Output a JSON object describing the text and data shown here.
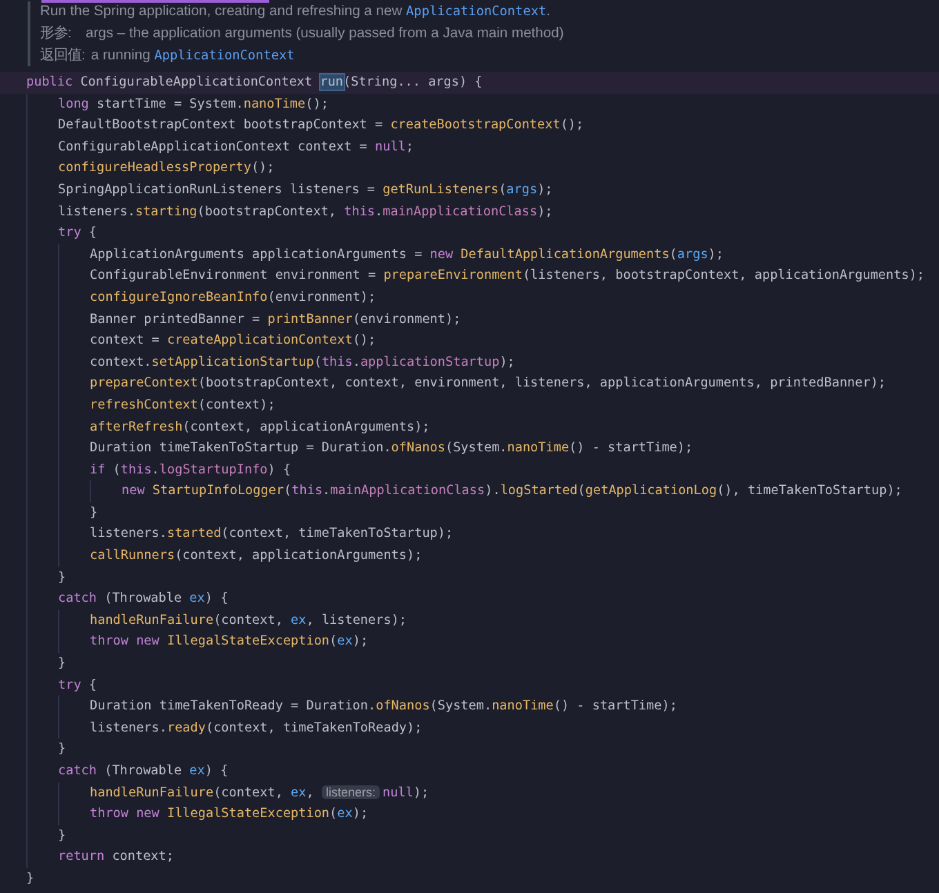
{
  "doc": [
    {
      "tokens": [
        {
          "kind": "text",
          "text": "Run the Spring application, creating and refreshing a new "
        },
        {
          "kind": "link",
          "text": "ApplicationContext"
        },
        {
          "kind": "text",
          "text": "."
        }
      ]
    },
    {
      "tokens": [
        {
          "kind": "label",
          "text": "形参:"
        },
        {
          "kind": "text",
          "text": "args – the application arguments (usually passed from a Java main method)"
        }
      ]
    },
    {
      "tokens": [
        {
          "kind": "label",
          "text": "返回值:"
        },
        {
          "kind": "text",
          "text": "a running "
        },
        {
          "kind": "link",
          "text": "ApplicationContext"
        }
      ]
    }
  ],
  "code": [
    {
      "tokens": [
        {
          "kind": "keyword",
          "text": "public"
        },
        {
          "kind": "plain",
          "text": " ConfigurableApplicationContext "
        },
        {
          "kind": "match",
          "text": "run"
        },
        {
          "kind": "plain",
          "text": "(String... args) {"
        }
      ],
      "children": [
        {
          "tokens": [
            {
              "kind": "keyword",
              "text": "long"
            },
            {
              "kind": "plain",
              "text": " startTime = System."
            },
            {
              "kind": "method",
              "text": "nanoTime"
            },
            {
              "kind": "plain",
              "text": "();"
            }
          ]
        },
        {
          "tokens": [
            {
              "kind": "plain",
              "text": "DefaultBootstrapContext bootstrapContext = "
            },
            {
              "kind": "method",
              "text": "createBootstrapContext"
            },
            {
              "kind": "plain",
              "text": "();"
            }
          ]
        },
        {
          "tokens": [
            {
              "kind": "plain",
              "text": "ConfigurableApplicationContext context = "
            },
            {
              "kind": "keyword",
              "text": "null"
            },
            {
              "kind": "plain",
              "text": ";"
            }
          ]
        },
        {
          "tokens": [
            {
              "kind": "method",
              "text": "configureHeadlessProperty"
            },
            {
              "kind": "plain",
              "text": "();"
            }
          ]
        },
        {
          "tokens": [
            {
              "kind": "plain",
              "text": "SpringApplicationRunListeners listeners = "
            },
            {
              "kind": "method",
              "text": "getRunListeners"
            },
            {
              "kind": "plain",
              "text": "("
            },
            {
              "kind": "param",
              "text": "args"
            },
            {
              "kind": "plain",
              "text": ");"
            }
          ]
        },
        {
          "tokens": [
            {
              "kind": "plain",
              "text": "listeners."
            },
            {
              "kind": "method",
              "text": "starting"
            },
            {
              "kind": "plain",
              "text": "(bootstrapContext, "
            },
            {
              "kind": "keyword",
              "text": "this"
            },
            {
              "kind": "plain",
              "text": "."
            },
            {
              "kind": "field",
              "text": "mainApplicationClass"
            },
            {
              "kind": "plain",
              "text": ");"
            }
          ]
        },
        {
          "tokens": [
            {
              "kind": "keyword",
              "text": "try"
            },
            {
              "kind": "plain",
              "text": " {"
            }
          ],
          "children": [
            {
              "tokens": [
                {
                  "kind": "plain",
                  "text": "ApplicationArguments applicationArguments = "
                },
                {
                  "kind": "keyword",
                  "text": "new "
                },
                {
                  "kind": "method",
                  "text": "DefaultApplicationArguments"
                },
                {
                  "kind": "plain",
                  "text": "("
                },
                {
                  "kind": "param",
                  "text": "args"
                },
                {
                  "kind": "plain",
                  "text": ");"
                }
              ]
            },
            {
              "tokens": [
                {
                  "kind": "plain",
                  "text": "ConfigurableEnvironment environment = "
                },
                {
                  "kind": "method",
                  "text": "prepareEnvironment"
                },
                {
                  "kind": "plain",
                  "text": "(listeners, bootstrapContext, applicationArguments);"
                }
              ]
            },
            {
              "tokens": [
                {
                  "kind": "method",
                  "text": "configureIgnoreBeanInfo"
                },
                {
                  "kind": "plain",
                  "text": "(environment);"
                }
              ]
            },
            {
              "tokens": [
                {
                  "kind": "plain",
                  "text": "Banner printedBanner = "
                },
                {
                  "kind": "method",
                  "text": "printBanner"
                },
                {
                  "kind": "plain",
                  "text": "(environment);"
                }
              ]
            },
            {
              "tokens": [
                {
                  "kind": "plain",
                  "text": "context = "
                },
                {
                  "kind": "method",
                  "text": "createApplicationContext"
                },
                {
                  "kind": "plain",
                  "text": "();"
                }
              ]
            },
            {
              "tokens": [
                {
                  "kind": "plain",
                  "text": "context."
                },
                {
                  "kind": "method",
                  "text": "setApplicationStartup"
                },
                {
                  "kind": "plain",
                  "text": "("
                },
                {
                  "kind": "keyword",
                  "text": "this"
                },
                {
                  "kind": "plain",
                  "text": "."
                },
                {
                  "kind": "field",
                  "text": "applicationStartup"
                },
                {
                  "kind": "plain",
                  "text": ");"
                }
              ]
            },
            {
              "tokens": [
                {
                  "kind": "method",
                  "text": "prepareContext"
                },
                {
                  "kind": "plain",
                  "text": "(bootstrapContext, context, environment, listeners, applicationArguments, printedBanner);"
                }
              ]
            },
            {
              "tokens": [
                {
                  "kind": "method",
                  "text": "refreshContext"
                },
                {
                  "kind": "plain",
                  "text": "(context);"
                }
              ]
            },
            {
              "tokens": [
                {
                  "kind": "method",
                  "text": "afterRefresh"
                },
                {
                  "kind": "plain",
                  "text": "(context, applicationArguments);"
                }
              ]
            },
            {
              "tokens": [
                {
                  "kind": "plain",
                  "text": "Duration timeTakenToStartup = Duration."
                },
                {
                  "kind": "method",
                  "text": "ofNanos"
                },
                {
                  "kind": "plain",
                  "text": "(System."
                },
                {
                  "kind": "method",
                  "text": "nanoTime"
                },
                {
                  "kind": "plain",
                  "text": "() - startTime);"
                }
              ]
            },
            {
              "tokens": [
                {
                  "kind": "keyword",
                  "text": "if"
                },
                {
                  "kind": "plain",
                  "text": " ("
                },
                {
                  "kind": "keyword",
                  "text": "this"
                },
                {
                  "kind": "plain",
                  "text": "."
                },
                {
                  "kind": "field",
                  "text": "logStartupInfo"
                },
                {
                  "kind": "plain",
                  "text": ") {"
                }
              ],
              "children": [
                {
                  "tokens": [
                    {
                      "kind": "keyword",
                      "text": "new "
                    },
                    {
                      "kind": "method",
                      "text": "StartupInfoLogger"
                    },
                    {
                      "kind": "plain",
                      "text": "("
                    },
                    {
                      "kind": "keyword",
                      "text": "this"
                    },
                    {
                      "kind": "plain",
                      "text": "."
                    },
                    {
                      "kind": "field",
                      "text": "mainApplicationClass"
                    },
                    {
                      "kind": "plain",
                      "text": ")."
                    },
                    {
                      "kind": "method",
                      "text": "logStarted"
                    },
                    {
                      "kind": "plain",
                      "text": "("
                    },
                    {
                      "kind": "method",
                      "text": "getApplicationLog"
                    },
                    {
                      "kind": "plain",
                      "text": "(), timeTakenToStartup);"
                    }
                  ]
                }
              ]
            },
            {
              "tokens": [
                {
                  "kind": "plain",
                  "text": "}"
                }
              ]
            },
            {
              "tokens": [
                {
                  "kind": "plain",
                  "text": "listeners."
                },
                {
                  "kind": "method",
                  "text": "started"
                },
                {
                  "kind": "plain",
                  "text": "(context, timeTakenToStartup);"
                }
              ]
            },
            {
              "tokens": [
                {
                  "kind": "method",
                  "text": "callRunners"
                },
                {
                  "kind": "plain",
                  "text": "(context, applicationArguments);"
                }
              ]
            }
          ]
        },
        {
          "tokens": [
            {
              "kind": "plain",
              "text": "}"
            }
          ]
        },
        {
          "tokens": [
            {
              "kind": "keyword",
              "text": "catch"
            },
            {
              "kind": "plain",
              "text": " (Throwable "
            },
            {
              "kind": "param",
              "text": "ex"
            },
            {
              "kind": "plain",
              "text": ") {"
            }
          ],
          "children": [
            {
              "tokens": [
                {
                  "kind": "method",
                  "text": "handleRunFailure"
                },
                {
                  "kind": "plain",
                  "text": "(context, "
                },
                {
                  "kind": "param",
                  "text": "ex"
                },
                {
                  "kind": "plain",
                  "text": ", listeners);"
                }
              ]
            },
            {
              "tokens": [
                {
                  "kind": "keyword",
                  "text": "throw new "
                },
                {
                  "kind": "method",
                  "text": "IllegalStateException"
                },
                {
                  "kind": "plain",
                  "text": "("
                },
                {
                  "kind": "param",
                  "text": "ex"
                },
                {
                  "kind": "plain",
                  "text": ");"
                }
              ]
            }
          ]
        },
        {
          "tokens": [
            {
              "kind": "plain",
              "text": "}"
            }
          ]
        },
        {
          "tokens": [
            {
              "kind": "keyword",
              "text": "try"
            },
            {
              "kind": "plain",
              "text": " {"
            }
          ],
          "children": [
            {
              "tokens": [
                {
                  "kind": "plain",
                  "text": "Duration timeTakenToReady = Duration."
                },
                {
                  "kind": "method",
                  "text": "ofNanos"
                },
                {
                  "kind": "plain",
                  "text": "(System."
                },
                {
                  "kind": "method",
                  "text": "nanoTime"
                },
                {
                  "kind": "plain",
                  "text": "() - startTime);"
                }
              ]
            },
            {
              "tokens": [
                {
                  "kind": "plain",
                  "text": "listeners."
                },
                {
                  "kind": "method",
                  "text": "ready"
                },
                {
                  "kind": "plain",
                  "text": "(context, timeTakenToReady);"
                }
              ]
            }
          ]
        },
        {
          "tokens": [
            {
              "kind": "plain",
              "text": "}"
            }
          ]
        },
        {
          "tokens": [
            {
              "kind": "keyword",
              "text": "catch"
            },
            {
              "kind": "plain",
              "text": " (Throwable "
            },
            {
              "kind": "param",
              "text": "ex"
            },
            {
              "kind": "plain",
              "text": ") {"
            }
          ],
          "children": [
            {
              "tokens": [
                {
                  "kind": "method",
                  "text": "handleRunFailure"
                },
                {
                  "kind": "plain",
                  "text": "(context, "
                },
                {
                  "kind": "param",
                  "text": "ex"
                },
                {
                  "kind": "plain",
                  "text": ", "
                },
                {
                  "kind": "hint",
                  "text": "listeners:"
                },
                {
                  "kind": "keyword",
                  "text": "null"
                },
                {
                  "kind": "plain",
                  "text": ");"
                }
              ]
            },
            {
              "tokens": [
                {
                  "kind": "keyword",
                  "text": "throw new "
                },
                {
                  "kind": "method",
                  "text": "IllegalStateException"
                },
                {
                  "kind": "plain",
                  "text": "("
                },
                {
                  "kind": "param",
                  "text": "ex"
                },
                {
                  "kind": "plain",
                  "text": ");"
                }
              ]
            }
          ]
        },
        {
          "tokens": [
            {
              "kind": "plain",
              "text": "}"
            }
          ]
        },
        {
          "tokens": [
            {
              "kind": "keyword",
              "text": "return"
            },
            {
              "kind": "plain",
              "text": " context;"
            }
          ]
        }
      ]
    },
    {
      "tokens": [
        {
          "kind": "plain",
          "text": "}"
        }
      ]
    }
  ]
}
